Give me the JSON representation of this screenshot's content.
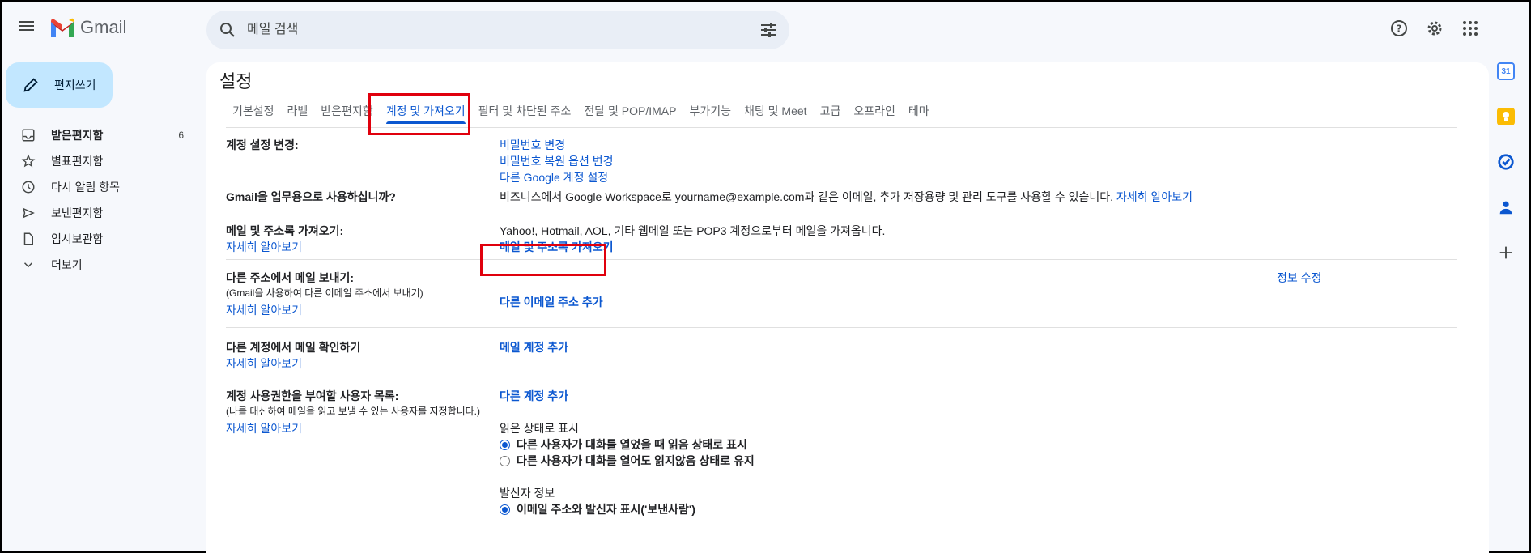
{
  "app": {
    "logo_text": "Gmail"
  },
  "search": {
    "placeholder": "메일 검색"
  },
  "compose": {
    "label": "편지쓰기"
  },
  "nav": {
    "items": [
      {
        "label": "받은편지함",
        "count": "6"
      },
      {
        "label": "별표편지함"
      },
      {
        "label": "다시 알림 항목"
      },
      {
        "label": "보낸편지함"
      },
      {
        "label": "임시보관함"
      },
      {
        "label": "더보기"
      }
    ]
  },
  "settings": {
    "title": "설정",
    "tabs": [
      "기본설정",
      "라벨",
      "받은편지함",
      "계정 및 가져오기",
      "필터 및 차단된 주소",
      "전달 및 POP/IMAP",
      "부가기능",
      "채팅 및 Meet",
      "고급",
      "오프라인",
      "테마"
    ],
    "active_tab": "계정 및 가져오기",
    "account": {
      "title": "계정 설정 변경:",
      "links": [
        "비밀번호 변경",
        "비밀번호 복원 옵션 변경",
        "다른 Google 계정 설정"
      ]
    },
    "workspace": {
      "title": "Gmail을 업무용으로 사용하십니까?",
      "text": "비즈니스에서 Google Workspace로 yourname@example.com과 같은 이메일, 추가 저장용량 및 관리 도구를 사용할 수 있습니다.",
      "link": "자세히 알아보기"
    },
    "import": {
      "title": "메일 및 주소록 가져오기:",
      "learn": "자세히 알아보기",
      "text": "Yahoo!, Hotmail, AOL, 기타 웹메일 또는 POP3 계정으로부터 메일을 가져옵니다.",
      "action": "메일 및 주소록 가져오기"
    },
    "send_as": {
      "title": "다른 주소에서 메일 보내기:",
      "sub": "(Gmail을 사용하여 다른 이메일 주소에서 보내기)",
      "learn": "자세히 알아보기",
      "edit": "정보 수정",
      "action": "다른 이메일 주소 추가"
    },
    "check_mail": {
      "title": "다른 계정에서 메일 확인하기",
      "learn": "자세히 알아보기",
      "action": "메일 계정 추가"
    },
    "delegate": {
      "title": "계정 사용권한을 부여할 사용자 목록:",
      "sub": "(나를 대신하여 메일을 읽고 보낼 수 있는 사용자를 지정합니다.)",
      "learn": "자세히 알아보기",
      "action": "다른 계정 추가",
      "read_status_heading": "읽은 상태로 표시",
      "read_options": [
        "다른 사용자가 대화를 열었을 때 읽음 상태로 표시",
        "다른 사용자가 대화를 열어도 읽지않음 상태로 유지"
      ],
      "sender_heading": "발신자 정보",
      "sender_options": [
        "이메일 주소와 발신자 표시('보낸사람')"
      ]
    }
  },
  "colors": {
    "accent": "#0b57d0",
    "highlight": "#e0000d",
    "compose_bg": "#c2e7ff"
  }
}
